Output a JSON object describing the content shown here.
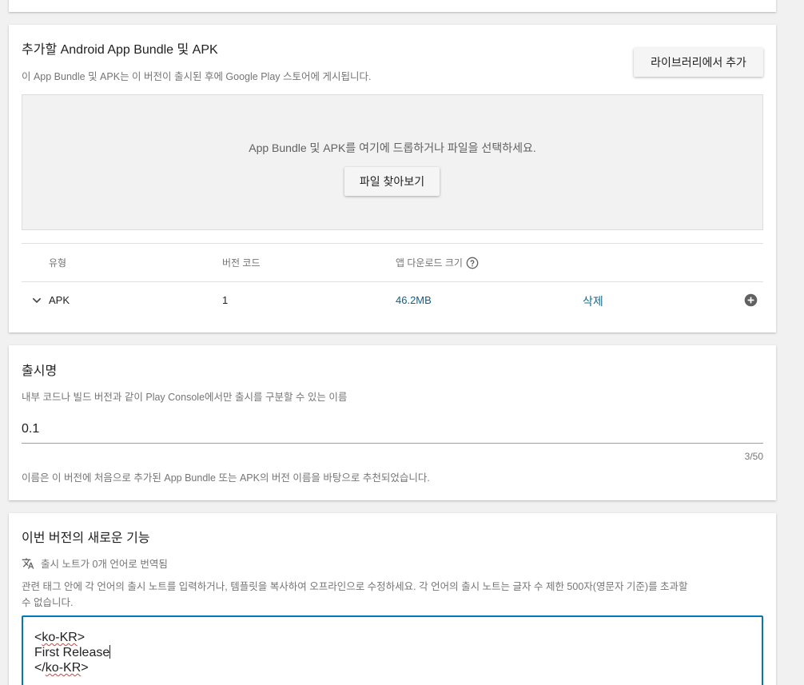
{
  "apk_section": {
    "title": "추가할 Android App Bundle 및 APK",
    "subtitle": "이 App Bundle 및 APK는 이 버전이 출시된 후에 Google Play 스토어에 게시됩니다.",
    "add_from_library_label": "라이브러리에서 추가",
    "dropzone_text": "App Bundle 및 APK를 여기에 드롭하거나 파일을 선택하세요.",
    "browse_label": "파일 찾아보기",
    "table": {
      "headers": {
        "type": "유형",
        "version_code": "버전 코드",
        "download_size": "앱 다운로드 크기"
      },
      "rows": [
        {
          "type": "APK",
          "version_code": "1",
          "download_size": "46.2MB",
          "delete_label": "삭제"
        }
      ]
    }
  },
  "release_name_section": {
    "title": "출시명",
    "subtitle": "내부 코드나 빌드 버전과 같이 Play Console에서만 출시를 구분할 수 있는 이름",
    "value": "0.1",
    "counter": "3/50",
    "hint": "이름은 이 버전에 처음으로 추가된 App Bundle 또는 APK의 버전 이름을 바탕으로 추천되었습니다."
  },
  "release_notes_section": {
    "title": "이번 버전의 새로운 기능",
    "translation_status": "출시 노트가 0개 언어로 번역됨",
    "instructions_line1": "관련 태그 안에 각 언어의 출시 노트를 입력하거나, 템플릿을 복사하여 오프라인으로 수정하세요. 각 언어의 출시 노트는 글자 수 제한 500자(영문자 기준)를 초과할",
    "instructions_line2": "수 없습니다.",
    "textarea": {
      "open_prefix": "<",
      "open_tag": "ko-KR",
      "open_suffix": ">",
      "body": "First Release",
      "close_prefix": "</",
      "close_tag": "ko-KR",
      "close_suffix": ">"
    }
  },
  "colors": {
    "link": "#0d5f8a",
    "link_delete": "#1a6a8f",
    "focus": "#0277bd",
    "background": "#f1f1f1"
  },
  "icons": [
    "help-circle-icon",
    "chevron-down-icon",
    "add-circle-icon",
    "translate-icon"
  ]
}
